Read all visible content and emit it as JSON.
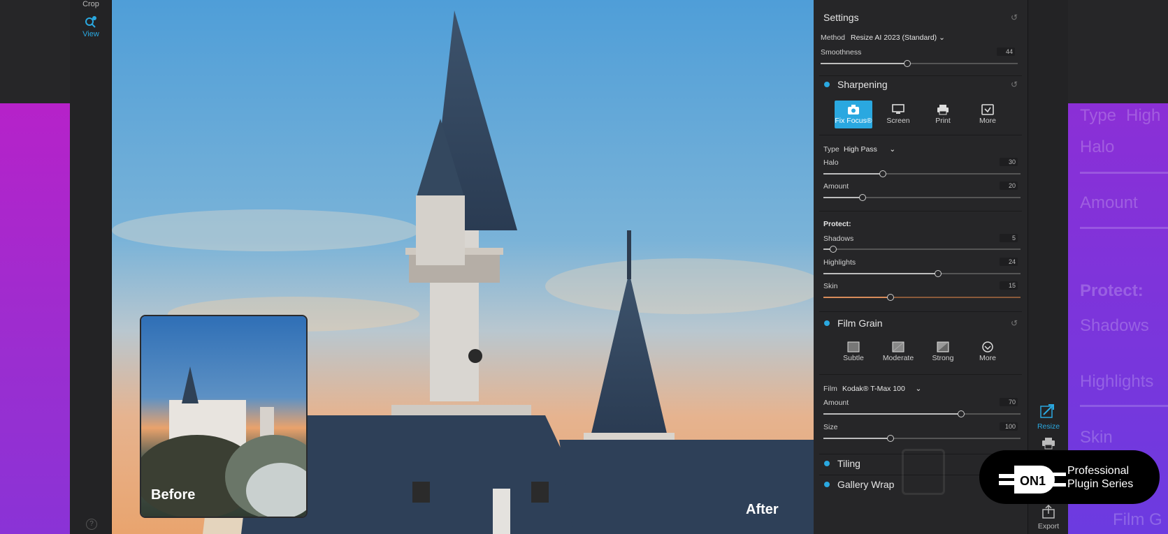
{
  "toolstrip": {
    "crop_label": "Crop",
    "view_label": "View"
  },
  "canvas": {
    "before_label": "Before",
    "after_label": "After"
  },
  "settings": {
    "title": "Settings",
    "method_label": "Method",
    "method_value": "Resize AI 2023 (Standard)",
    "smoothness_label": "Smoothness",
    "smoothness_value": "44",
    "smoothness_level": 0.44
  },
  "sharpening": {
    "title": "Sharpening",
    "modes": [
      {
        "label": "Fix Focus®",
        "active": true,
        "icon": "camera-icon"
      },
      {
        "label": "Screen",
        "active": false,
        "icon": "monitor-icon"
      },
      {
        "label": "Print",
        "active": false,
        "icon": "printer-icon"
      },
      {
        "label": "More",
        "active": false,
        "icon": "checkbox-icon"
      }
    ],
    "type_label": "Type",
    "type_value": "High Pass",
    "halo_label": "Halo",
    "halo_value": "30",
    "halo_level": 0.3,
    "amount_label": "Amount",
    "amount_value": "20",
    "amount_level": 0.2,
    "protect_label": "Protect:",
    "shadows_label": "Shadows",
    "shadows_value": "5",
    "shadows_level": 0.05,
    "highlights_label": "Highlights",
    "highlights_value": "24",
    "highlights_level": 0.58,
    "skin_label": "Skin",
    "skin_value": "15",
    "skin_level": 0.34
  },
  "film_grain": {
    "title": "Film Grain",
    "presets": [
      {
        "label": "Subtle",
        "icon": "grain-subtle-icon"
      },
      {
        "label": "Moderate",
        "icon": "grain-moderate-icon"
      },
      {
        "label": "Strong",
        "icon": "grain-strong-icon"
      },
      {
        "label": "More",
        "icon": "chevron-circle-icon"
      }
    ],
    "film_label": "Film",
    "film_value": "Kodak® T-Max 100",
    "amount_label": "Amount",
    "amount_value": "70",
    "amount_level": 0.7,
    "size_label": "Size",
    "size_value": "100",
    "size_level": 0.34
  },
  "tiling": {
    "title": "Tiling"
  },
  "gallery_wrap": {
    "title": "Gallery Wrap"
  },
  "iconstrip": {
    "resize_label": "Resize",
    "export_label": "Export"
  },
  "badge": {
    "line1": "Professional",
    "line2": "Plugin Series"
  },
  "background_ghost": {
    "type": "Type",
    "high": "High",
    "halo": "Halo",
    "amount": "Amount",
    "protect": "Protect:",
    "shadows": "Shadows",
    "highlights": "Highlights",
    "skin": "Skin",
    "film": "Film G"
  },
  "colors": {
    "accent": "#2aa8e0",
    "panel_bg": "#262628",
    "purple": "#9a2ed0"
  }
}
